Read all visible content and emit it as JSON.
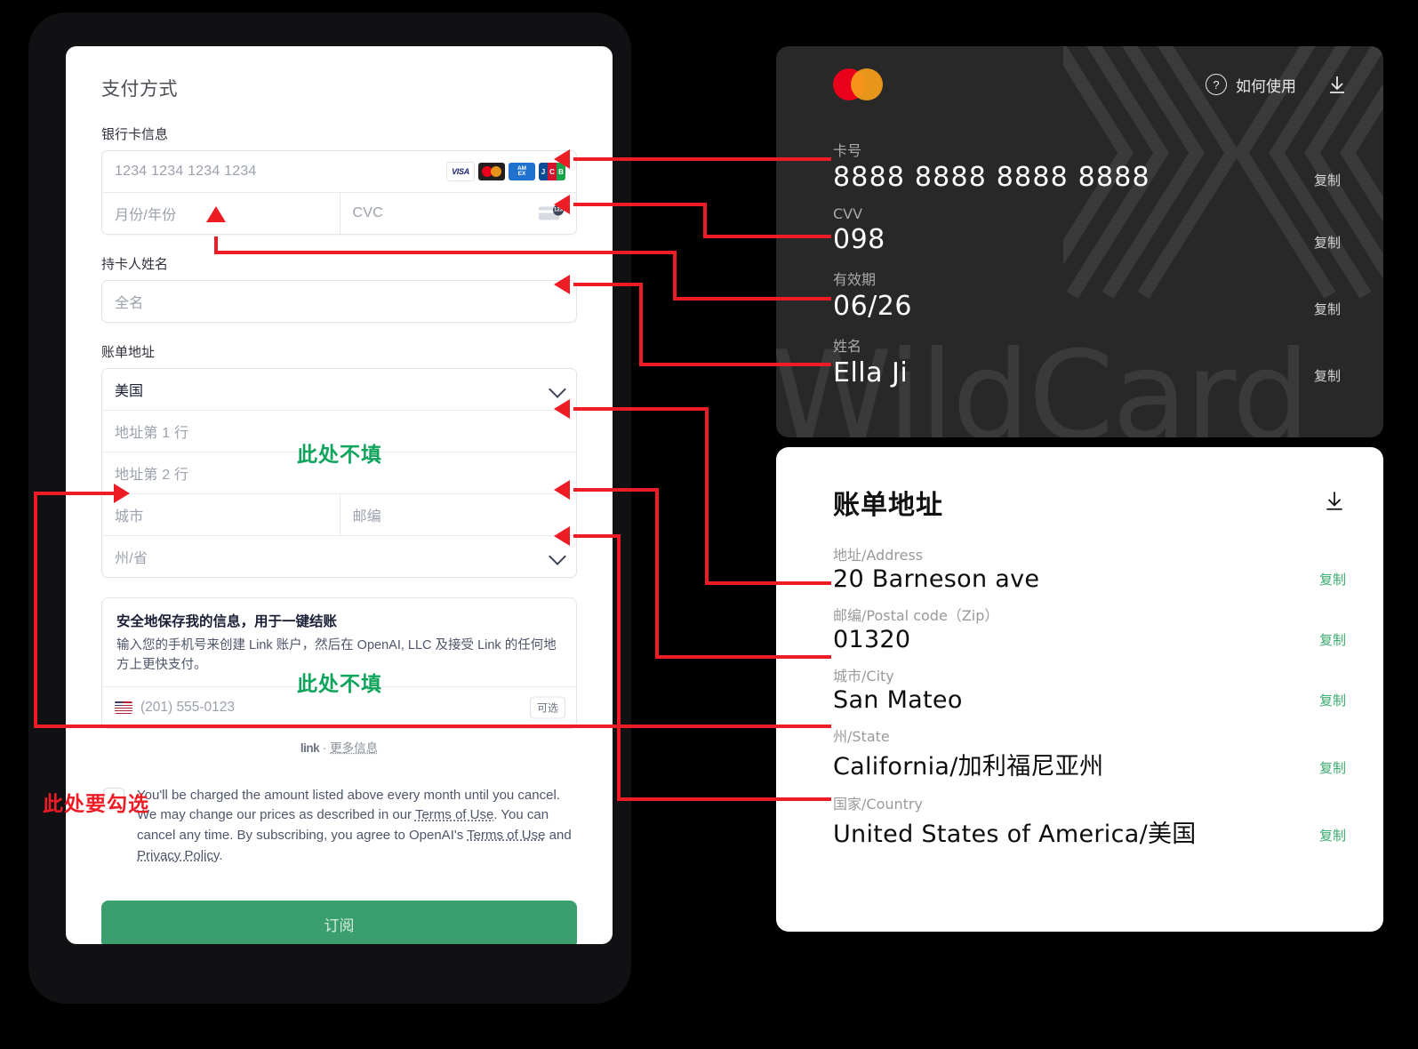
{
  "payment_form": {
    "title": "支付方式",
    "card_info_label": "银行卡信息",
    "card_number_placeholder": "1234 1234 1234 1234",
    "expiry_placeholder": "月份/年份",
    "cvc_placeholder": "CVC",
    "cvc_icon_digits": "123",
    "brands": [
      "VISA",
      "mastercard",
      "AMEX",
      "JCB"
    ],
    "amex_line1": "AM",
    "amex_line2": "EX",
    "jcb_letters": [
      "J",
      "C",
      "B"
    ],
    "cardholder_label": "持卡人姓名",
    "cardholder_placeholder": "全名",
    "billing_label": "账单地址",
    "country_value": "美国",
    "address1_placeholder": "地址第 1 行",
    "address2_placeholder": "地址第 2 行",
    "city_placeholder": "城市",
    "zip_placeholder": "邮编",
    "state_placeholder": "州/省",
    "link_title": "安全地保存我的信息，用于一键结账",
    "link_desc": "输入您的手机号来创建 Link 账户，然后在 OpenAI, LLC 及接受 Link 的任何地方上更快支付。",
    "phone_placeholder": "(201) 555-0123",
    "optional_badge": "可选",
    "link_brand": "link",
    "link_dot": "·",
    "link_more": "更多信息",
    "terms_text": "You'll be charged the amount listed above every month until you cancel. We may change our prices as described in our ",
    "terms_link1": "Terms of Use",
    "terms_text2": ". You can cancel any time. By subscribing, you agree to OpenAI's ",
    "terms_link2": "Terms of Use",
    "terms_and": " and ",
    "terms_link3": "Privacy Policy",
    "terms_period": ".",
    "subscribe_label": "订阅"
  },
  "wildcard": {
    "howto_label": "如何使用",
    "watermark": "WildCard",
    "rows": [
      {
        "label": "卡号",
        "value": "8888 8888 8888 8888",
        "copy": "复制"
      },
      {
        "label": "CVV",
        "value": "098",
        "copy": "复制"
      },
      {
        "label": "有效期",
        "value": "06/26",
        "copy": "复制"
      },
      {
        "label": "姓名",
        "value": "Ella Ji",
        "copy": "复制"
      }
    ]
  },
  "billing_panel": {
    "title": "账单地址",
    "rows": [
      {
        "label": "地址/Address",
        "value": "20 Barneson ave",
        "copy": "复制"
      },
      {
        "label": "邮编/Postal code（Zip）",
        "value": "01320",
        "copy": "复制"
      },
      {
        "label": "城市/City",
        "value": "San Mateo",
        "copy": "复制"
      },
      {
        "label": "州/State",
        "value": "California/加利福尼亚州",
        "copy": "复制"
      },
      {
        "label": "国家/Country",
        "value": "United States of America/美国",
        "copy": "复制"
      }
    ]
  },
  "annotations": {
    "skip_address2": "此处不填",
    "skip_phone": "此处不填",
    "must_check": "此处要勾选",
    "arrow_color": "#ee1c25",
    "green_color": "#0fa45c"
  }
}
